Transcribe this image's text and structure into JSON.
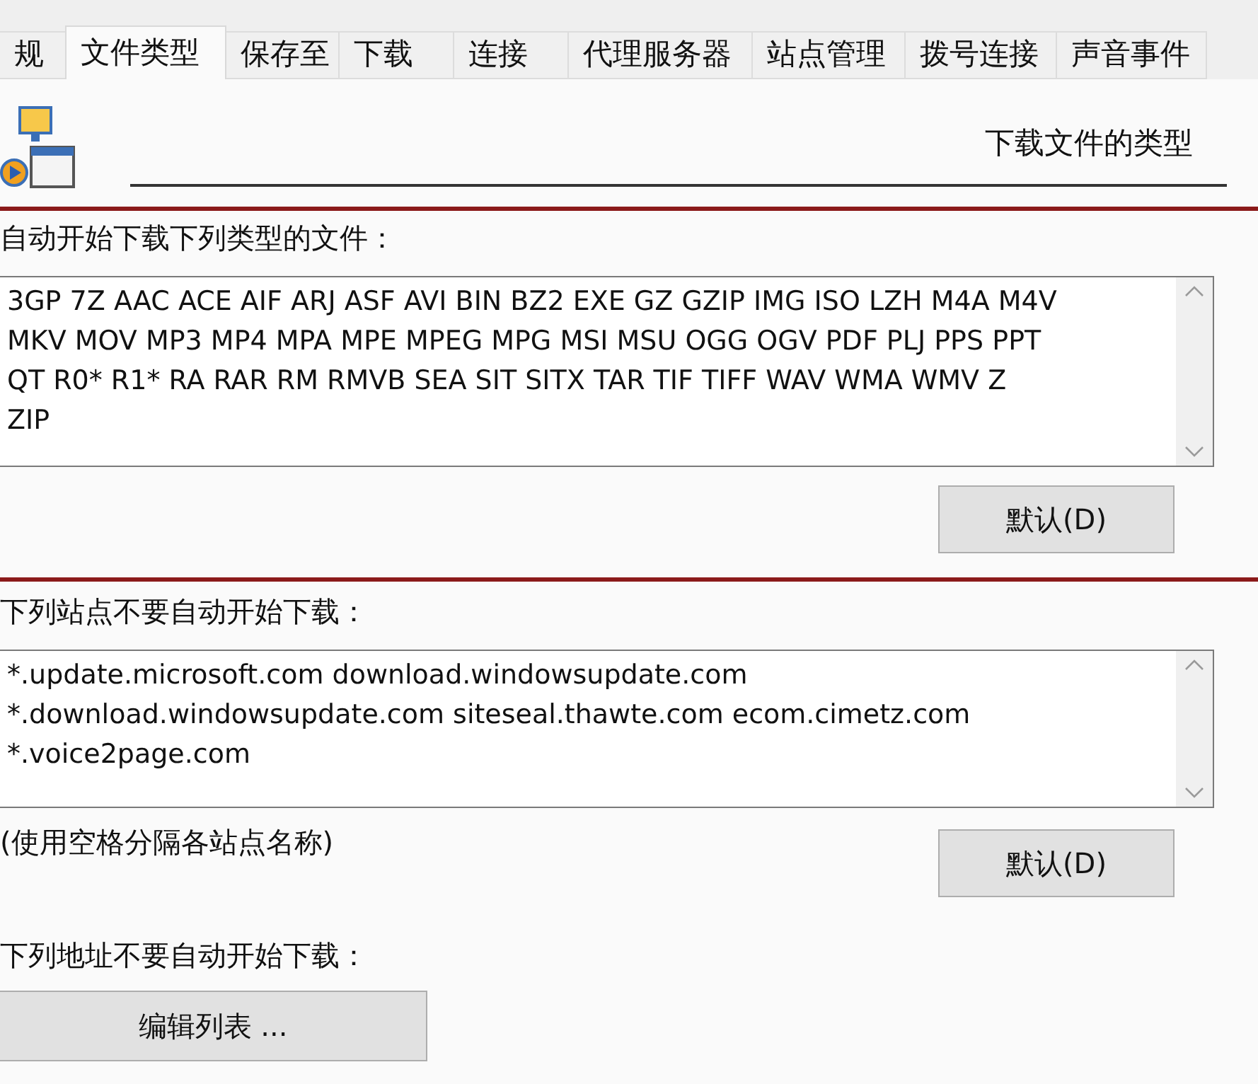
{
  "tabs": [
    {
      "label": "规",
      "selected": false
    },
    {
      "label": "文件类型",
      "selected": true
    },
    {
      "label": "保存至",
      "selected": false
    },
    {
      "label": "下载",
      "selected": false
    },
    {
      "label": "连接",
      "selected": false
    },
    {
      "label": "代理服务器",
      "selected": false
    },
    {
      "label": "站点管理",
      "selected": false
    },
    {
      "label": "拨号连接",
      "selected": false
    },
    {
      "label": "声音事件",
      "selected": false
    }
  ],
  "header": {
    "title": "下载文件的类型"
  },
  "file_types": {
    "label": "自动开始下载下列类型的文件：",
    "lines": [
      "3GP 7Z AAC ACE AIF ARJ ASF AVI BIN BZ2 EXE GZ GZIP IMG ISO LZH M4A M4V",
      "MKV MOV MP3 MP4 MPA MPE MPEG MPG MSI MSU OGG OGV PDF PLJ PPS PPT",
      "QT R0* R1* RA RAR RM RMVB SEA SIT SITX TAR TIF TIFF WAV WMA WMV Z",
      "ZIP"
    ],
    "button": "默认(D)"
  },
  "sites": {
    "label": "下列站点不要自动开始下载：",
    "lines": [
      "*.update.microsoft.com download.windowsupdate.com",
      "*.download.windowsupdate.com siteseal.thawte.com ecom.cimetz.com",
      "*.voice2page.com"
    ],
    "hint": "(使用空格分隔各站点名称)",
    "button": "默认(D)"
  },
  "addresses": {
    "label": "下列地址不要自动开始下载：",
    "button": "编辑列表 ..."
  }
}
